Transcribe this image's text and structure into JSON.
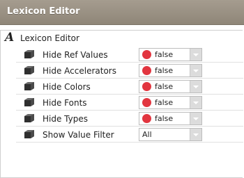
{
  "window": {
    "title": "Lexicon Editor"
  },
  "header": {
    "label": "Lexicon Editor",
    "icon": "italic-a-icon"
  },
  "rows": [
    {
      "label": "Hide Ref Values",
      "value": "false",
      "status_color": "#e2353f"
    },
    {
      "label": "Hide Accelerators",
      "value": "false",
      "status_color": "#e2353f"
    },
    {
      "label": "Hide Colors",
      "value": "false",
      "status_color": "#e2353f"
    },
    {
      "label": "Hide Fonts",
      "value": "false",
      "status_color": "#e2353f"
    },
    {
      "label": "Hide Types",
      "value": "false",
      "status_color": "#e2353f"
    },
    {
      "label": "Show Value Filter",
      "value": "All"
    }
  ]
}
